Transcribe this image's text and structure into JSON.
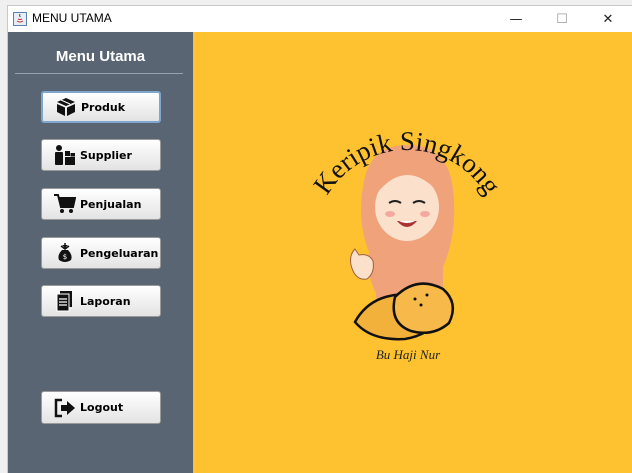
{
  "window": {
    "title": "MENU UTAMA",
    "controls": {
      "minimize": "—",
      "maximize": "☐",
      "close": "✕"
    }
  },
  "sidebar": {
    "title": "Menu Utama",
    "items": [
      {
        "label": "Produk",
        "icon": "boxes-icon"
      },
      {
        "label": "Supplier",
        "icon": "supplier-icon"
      },
      {
        "label": "Penjualan",
        "icon": "cart-icon"
      },
      {
        "label": "Pengeluaran",
        "icon": "money-bag-icon"
      },
      {
        "label": "Laporan",
        "icon": "document-icon"
      }
    ],
    "logout": {
      "label": "Logout",
      "icon": "logout-icon"
    }
  },
  "logo": {
    "title": "Keripik Singkong",
    "signature": "Bu Haji Nur"
  },
  "colors": {
    "sidebar": "#5a6573",
    "main": "#fec231",
    "active_border": "#7fa6cf"
  }
}
